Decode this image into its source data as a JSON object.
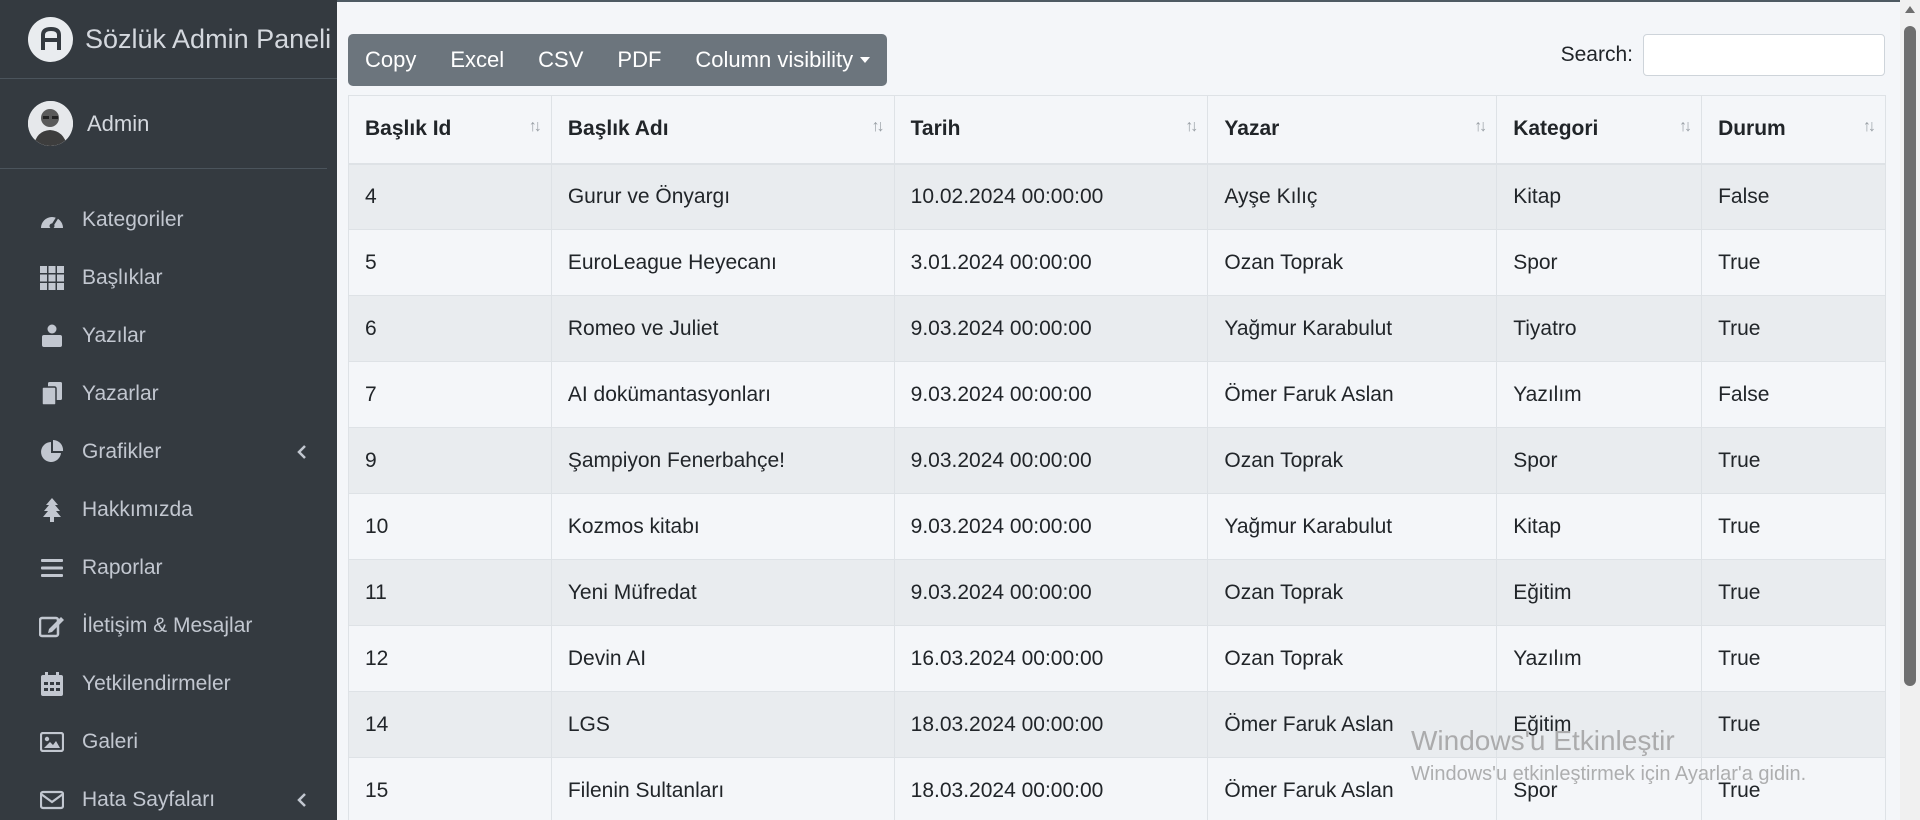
{
  "brand": {
    "title": "Sözlük Admin Paneli"
  },
  "user": {
    "name": "Admin"
  },
  "sidebar": {
    "items": [
      {
        "label": "Kategoriler",
        "icon": "tachometer-icon"
      },
      {
        "label": "Başlıklar",
        "icon": "grid-icon"
      },
      {
        "label": "Yazılar",
        "icon": "user-box-icon"
      },
      {
        "label": "Yazarlar",
        "icon": "copy-icon"
      },
      {
        "label": "Grafikler",
        "icon": "pie-chart-icon",
        "has_submenu": true
      },
      {
        "label": "Hakkımızda",
        "icon": "tree-icon"
      },
      {
        "label": "Raporlar",
        "icon": "bars-icon"
      },
      {
        "label": "İletişim & Mesajlar",
        "icon": "edit-icon"
      },
      {
        "label": "Yetkilendirmeler",
        "icon": "calendar-icon"
      },
      {
        "label": "Galeri",
        "icon": "image-icon"
      },
      {
        "label": "Hata Sayfaları",
        "icon": "envelope-icon",
        "has_submenu": true
      }
    ]
  },
  "toolbar": {
    "copy": "Copy",
    "excel": "Excel",
    "csv": "CSV",
    "pdf": "PDF",
    "column_visibility": "Column visibility"
  },
  "search": {
    "label": "Search:",
    "value": ""
  },
  "table": {
    "headers": [
      "Başlık Id",
      "Başlık Adı",
      "Tarih",
      "Yazar",
      "Kategori",
      "Durum"
    ],
    "rows": [
      [
        "4",
        "Gurur ve Önyargı",
        "10.02.2024 00:00:00",
        "Ayşe Kılıç",
        "Kitap",
        "False"
      ],
      [
        "5",
        "EuroLeague Heyecanı",
        "3.01.2024 00:00:00",
        "Ozan Toprak",
        "Spor",
        "True"
      ],
      [
        "6",
        "Romeo ve Juliet",
        "9.03.2024 00:00:00",
        "Yağmur Karabulut",
        "Tiyatro",
        "True"
      ],
      [
        "7",
        "AI dokümantasyonları",
        "9.03.2024 00:00:00",
        "Ömer Faruk Aslan",
        "Yazılım",
        "False"
      ],
      [
        "9",
        "Şampiyon Fenerbahçe!",
        "9.03.2024 00:00:00",
        "Ozan Toprak",
        "Spor",
        "True"
      ],
      [
        "10",
        "Kozmos kitabı",
        "9.03.2024 00:00:00",
        "Yağmur Karabulut",
        "Kitap",
        "True"
      ],
      [
        "11",
        "Yeni Müfredat",
        "9.03.2024 00:00:00",
        "Ozan Toprak",
        "Eğitim",
        "True"
      ],
      [
        "12",
        "Devin AI",
        "16.03.2024 00:00:00",
        "Ozan Toprak",
        "Yazılım",
        "True"
      ],
      [
        "14",
        "LGS",
        "18.03.2024 00:00:00",
        "Ömer Faruk Aslan",
        "Eğitim",
        "True"
      ],
      [
        "15",
        "Filenin Sultanları",
        "18.03.2024 00:00:00",
        "Ömer Faruk Aslan",
        "Spor",
        "True"
      ]
    ]
  },
  "watermark": {
    "title": "Windows'u Etkinleştir",
    "subtitle": "Windows'u etkinleştirmek için Ayarlar'a gidin."
  },
  "colors": {
    "sidebar_bg": "#343a40",
    "button_bg": "#6c757d",
    "content_bg": "#f4f6f9"
  }
}
